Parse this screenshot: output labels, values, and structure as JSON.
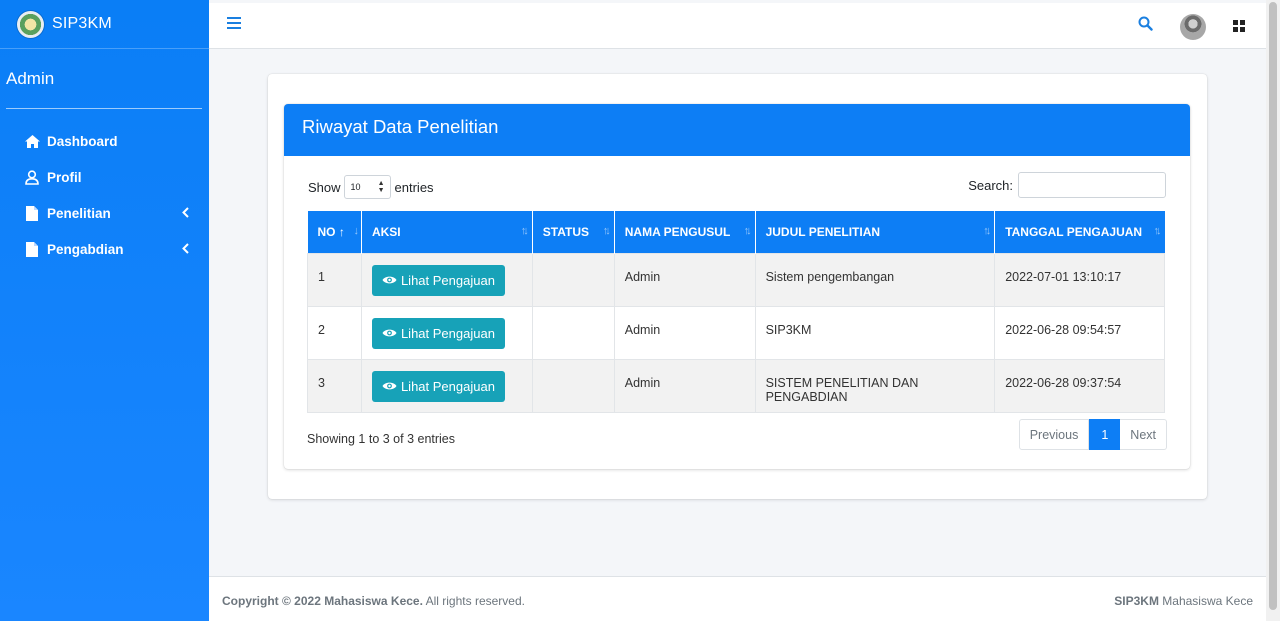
{
  "brand": {
    "name": "SIP3KM"
  },
  "sidebar": {
    "user": "Admin",
    "items": [
      {
        "label": "Dashboard",
        "icon": "home-icon",
        "has_caret": false
      },
      {
        "label": "Profil",
        "icon": "user-icon",
        "has_caret": false
      },
      {
        "label": "Penelitian",
        "icon": "file-icon",
        "has_caret": true
      },
      {
        "label": "Pengabdian",
        "icon": "file-icon",
        "has_caret": true
      }
    ]
  },
  "topbar": {
    "icons": [
      "menu-icon",
      "search-icon",
      "user-avatar",
      "apps-grid-icon"
    ]
  },
  "card": {
    "title": "Riwayat Data Penelitian"
  },
  "controls": {
    "show_label": "Show",
    "length_value": "10",
    "entries_label": "entries",
    "search_label": "Search:",
    "search_value": ""
  },
  "table": {
    "columns": [
      "NO",
      "AKSI",
      "STATUS",
      "NAMA PENGUSUL",
      "JUDUL PENELITIAN",
      "TANGGAL PENGAJUAN"
    ],
    "sorted_column": "NO",
    "rows": [
      {
        "no": "1",
        "aksi": "Lihat Pengajuan",
        "status": "",
        "nama": "Admin",
        "judul": "Sistem pengembangan",
        "tanggal": "2022-07-01 13:10:17"
      },
      {
        "no": "2",
        "aksi": "Lihat Pengajuan",
        "status": "",
        "nama": "Admin",
        "judul": "SIP3KM",
        "tanggal": "2022-06-28 09:54:57"
      },
      {
        "no": "3",
        "aksi": "Lihat Pengajuan",
        "status": "",
        "nama": "Admin",
        "judul": "SISTEM PENELITIAN DAN PENGABDIAN",
        "tanggal": "2022-06-28 09:37:54"
      }
    ]
  },
  "pagination": {
    "info": "Showing 1 to 3 of 3 entries",
    "previous": "Previous",
    "current": "1",
    "next": "Next"
  },
  "footer": {
    "copyright_strong": "Copyright © 2022 Mahasiswa Kece.",
    "copyright_rest": " All rights reserved.",
    "right_strong": "SIP3KM",
    "right_rest": " Mahasiswa Kece"
  },
  "colors": {
    "primary": "#0d7ef5",
    "info_button": "#17a2b8",
    "sidebar": "#1a86ff"
  }
}
